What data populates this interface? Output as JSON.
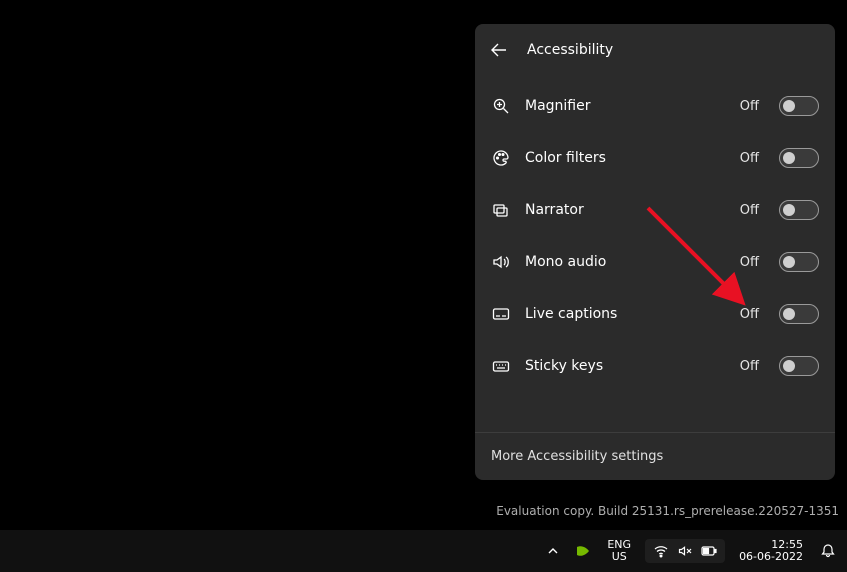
{
  "panel": {
    "title": "Accessibility",
    "rows": [
      {
        "icon": "magnifier-icon",
        "label": "Magnifier",
        "state": "Off"
      },
      {
        "icon": "palette-icon",
        "label": "Color filters",
        "state": "Off"
      },
      {
        "icon": "narrator-icon",
        "label": "Narrator",
        "state": "Off"
      },
      {
        "icon": "speaker-icon",
        "label": "Mono audio",
        "state": "Off"
      },
      {
        "icon": "captions-icon",
        "label": "Live captions",
        "state": "Off"
      },
      {
        "icon": "keyboard-icon",
        "label": "Sticky keys",
        "state": "Off"
      }
    ],
    "footer": "More Accessibility settings"
  },
  "watermark": "Evaluation copy. Build 25131.rs_prerelease.220527-1351",
  "taskbar": {
    "lang_top": "ENG",
    "lang_bottom": "US",
    "time": "12:55",
    "date": "06-06-2022"
  },
  "colors": {
    "arrow": "#e81123"
  }
}
